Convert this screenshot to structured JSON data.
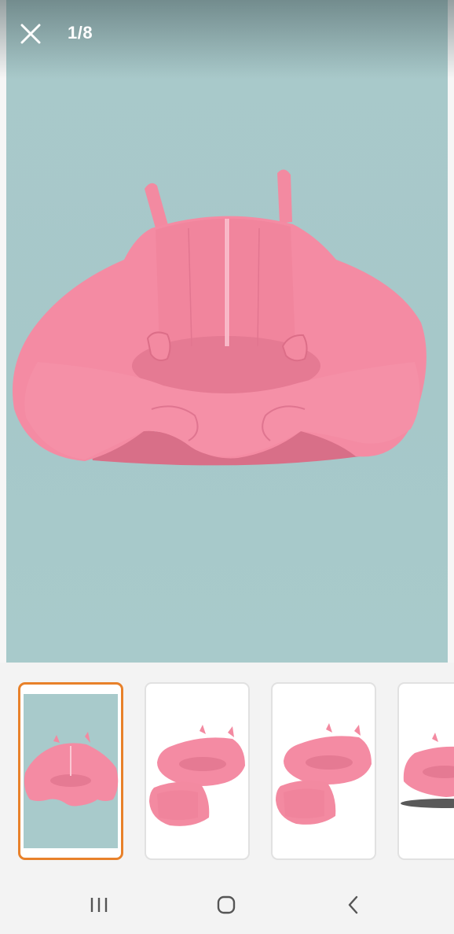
{
  "viewer": {
    "counter": "1/8",
    "icons": {
      "close": "close-icon"
    }
  },
  "thumbnails": [
    {
      "index": 1,
      "selected": true,
      "image": "pink-baby-seat-teal-background"
    },
    {
      "index": 2,
      "selected": false,
      "image": "pink-baby-seat-with-tray"
    },
    {
      "index": 3,
      "selected": false,
      "image": "pink-baby-seat-with-tray"
    },
    {
      "index": 4,
      "selected": false,
      "image": "pink-baby-seat-partial"
    }
  ],
  "navigation": {
    "icons": [
      "recent-apps-icon",
      "home-icon",
      "back-icon"
    ]
  },
  "colors": {
    "accent": "#e8812a",
    "product_pink": "#f48ba3",
    "background_teal": "#a8cacb"
  }
}
